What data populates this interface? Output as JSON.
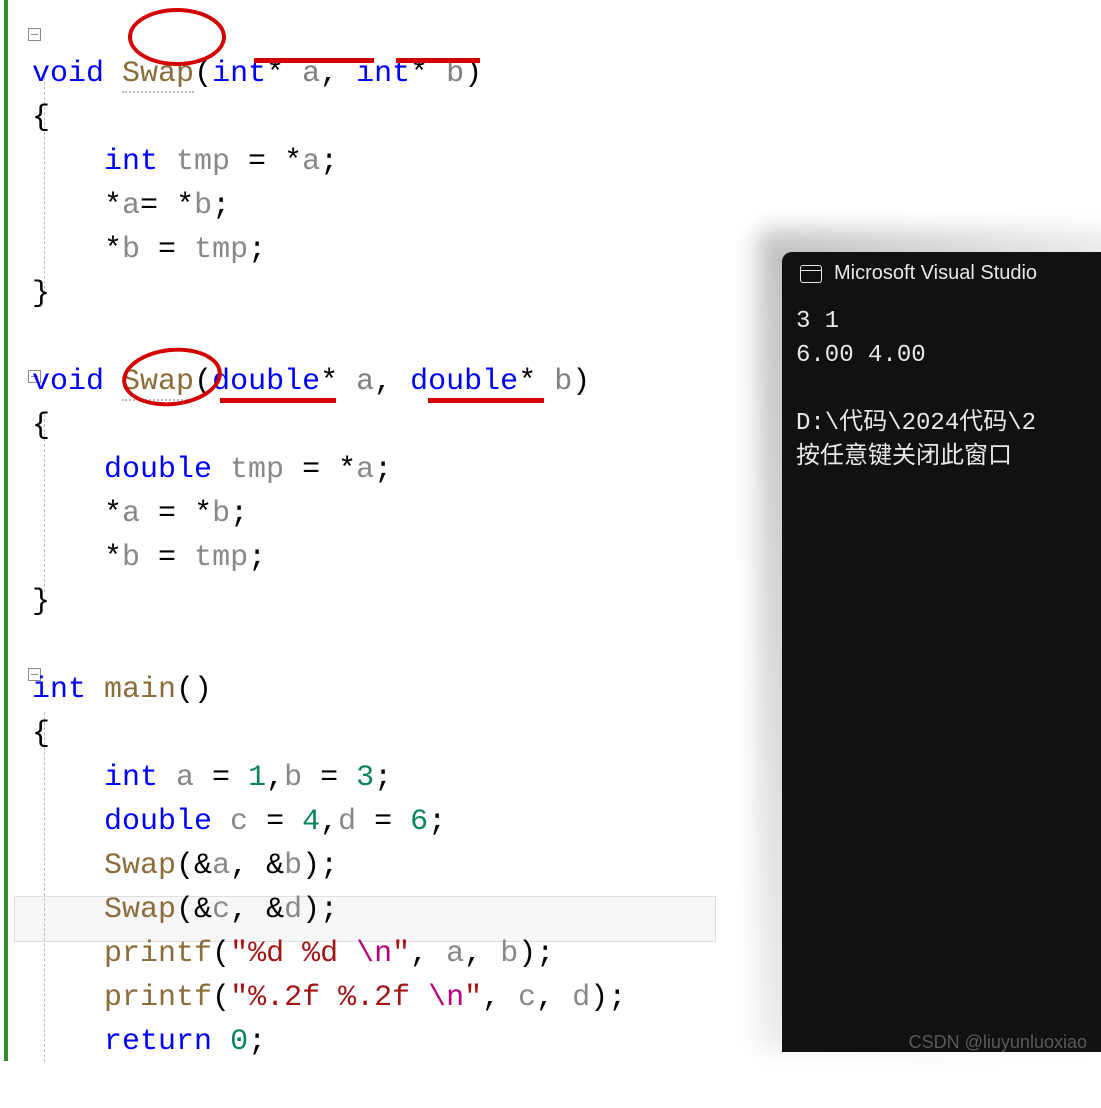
{
  "code": {
    "line1": {
      "void": "void",
      "swap": "Swap",
      "lp": "(",
      "int1": "int",
      "star1": "* ",
      "a": "a",
      "comma": ", ",
      "int2": "int",
      "star2": "* ",
      "b": "b",
      "rp": ")"
    },
    "line2": "{",
    "line3": {
      "int": "int",
      "tmp": " tmp ",
      "eq": "= ",
      "star": "*",
      "a": "a",
      "semi": ";"
    },
    "line4": {
      "star1": "*",
      "a": "a",
      "eq": "= ",
      "star2": "*",
      "b": "b",
      "semi": ";"
    },
    "line5": {
      "star": "*",
      "b": "b",
      "eq": " = ",
      "tmp": "tmp",
      "semi": ";"
    },
    "line6": "}",
    "line8": {
      "void": "void",
      "swap": "Swap",
      "lp": "(",
      "d1": "double",
      "star1": "* ",
      "a": "a",
      "comma": ", ",
      "d2": "double",
      "star2": "* ",
      "b": "b",
      "rp": ")"
    },
    "line9": "{",
    "line10": {
      "double": "double",
      "tmp": " tmp ",
      "eq": "= ",
      "star": "*",
      "a": "a",
      "semi": ";"
    },
    "line11": {
      "star1": "*",
      "a": "a",
      "eq": " = ",
      "star2": "*",
      "b": "b",
      "semi": ";"
    },
    "line12": {
      "star": "*",
      "b": "b",
      "eq": " = ",
      "tmp": "tmp",
      "semi": ";"
    },
    "line13": "}",
    "line15": {
      "int": "int",
      "main": " main",
      "paren": "()"
    },
    "line16": "{",
    "line17": {
      "int": "int",
      "a": " a ",
      "eq1": "= ",
      "v1": "1",
      "c1": ",",
      "b": "b ",
      "eq2": "= ",
      "v2": "3",
      "semi": ";"
    },
    "line18": {
      "double": "double",
      "c": " c ",
      "eq1": "= ",
      "v1": "4",
      "c1": ",",
      "d": "d ",
      "eq2": "= ",
      "v2": "6",
      "semi": ";"
    },
    "line19": {
      "swap": "Swap",
      "lp": "(",
      "amp1": "&",
      "a": "a",
      "comma": ", ",
      "amp2": "&",
      "b": "b",
      "rp": ");"
    },
    "line20": {
      "swap": "Swap",
      "lp": "(",
      "amp1": "&",
      "c": "c",
      "comma": ", ",
      "amp2": "&",
      "d": "d",
      "rp": ");"
    },
    "line21": {
      "printf": "printf",
      "lp": "(",
      "q1": "\"",
      "fmt": "%d %d ",
      "esc": "\\n",
      "q2": "\"",
      "comma1": ", ",
      "a": "a",
      "comma2": ", ",
      "b": "b",
      "rp": ");"
    },
    "line22": {
      "printf": "printf",
      "lp": "(",
      "q1": "\"",
      "fmt": "%.2f %.2f ",
      "esc": "\\n",
      "q2": "\"",
      "comma1": ", ",
      "c": "c",
      "comma2": ", ",
      "d": "d",
      "rp": ");"
    },
    "line23": {
      "return": "return",
      "sp": " ",
      "zero": "0",
      "semi": ";"
    }
  },
  "console": {
    "title": "Microsoft Visual Studio",
    "out1": "3 1",
    "out2": "6.00 4.00",
    "path": "D:\\代码\\2024代码\\2",
    "hint": "按任意键关闭此窗口"
  },
  "watermark": "CSDN @liuyunluoxiao"
}
